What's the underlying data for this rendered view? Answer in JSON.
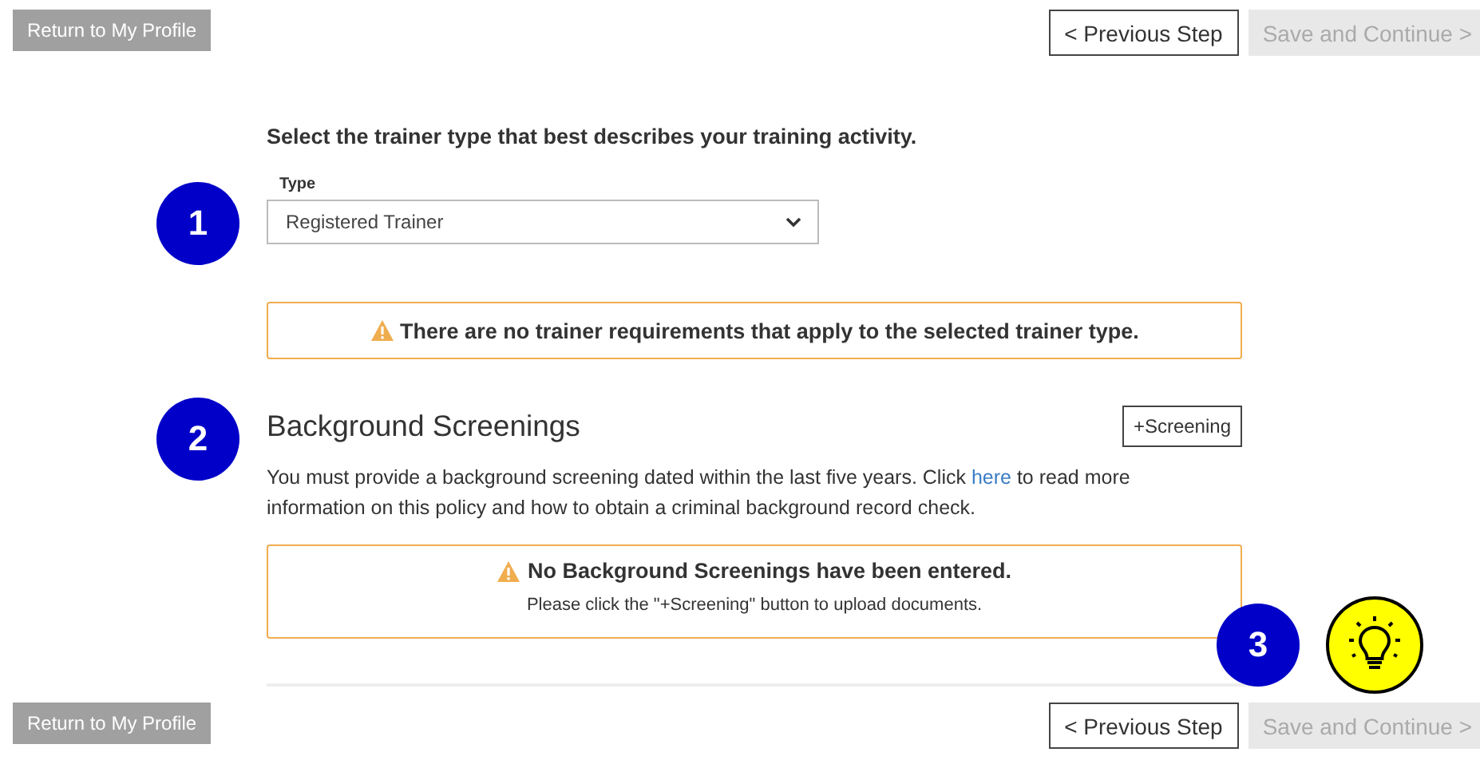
{
  "top_nav": {
    "return_button": "Return to My Profile",
    "previous_button": {
      "label": "< Previous Step",
      "disabled": false
    },
    "save_button": {
      "label": "Save and Continue >",
      "disabled": true
    }
  },
  "trainer_type": {
    "prompt": "Select the trainer type that best describes your training activity.",
    "field_label": "Type",
    "value": "Registered Trainer",
    "alert": "There are no trainer requirements that apply to the selected trainer type."
  },
  "background_screenings": {
    "title": "Background Screenings",
    "add_button": "+Screening",
    "text_before_link": "You must provide a background screening dated within the last five years. Click ",
    "link": "here",
    "text_after_link": " to read more information on this policy and how to obtain a criminal background record check.",
    "alert_title": "No Background Screenings have been entered.",
    "alert_text": "Please click the \"+Screening\" button to upload documents."
  },
  "callouts": [
    {
      "label": "1"
    },
    {
      "label": "2"
    },
    {
      "label": "3"
    }
  ],
  "bottom_nav": {
    "return_button": "Return to My Profile",
    "previous_button": {
      "label": "< Previous Step",
      "disabled": false
    },
    "save_button": {
      "label": "Save and Continue >",
      "disabled": true
    }
  }
}
